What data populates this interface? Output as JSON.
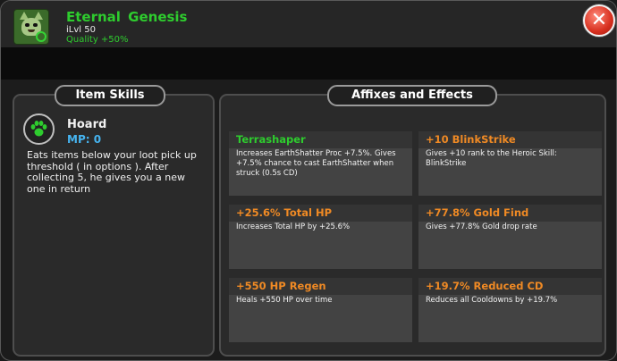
{
  "header": {
    "item_name": "Eternal Genesis",
    "ilvl": "iLvl 50",
    "quality": "Quality +50%",
    "close_icon": "close-x-icon",
    "pet_icon": "green-creature-portrait-icon"
  },
  "skills_panel": {
    "title": "Item Skills",
    "skill": {
      "icon": "paw-icon",
      "name": "Hoard",
      "mp": "MP: 0",
      "description": "Eats items below your loot pick up threshold ( in options ). After collecting 5, he gives you a new one in return"
    }
  },
  "affixes_panel": {
    "title": "Affixes and Effects",
    "cards": [
      {
        "name": "Terrashaper",
        "desc": "Increases EarthShatter Proc +7.5%. Gives +7.5% chance to cast EarthShatter when struck (0.5s CD)",
        "color": "#2ecc2e"
      },
      {
        "name": "+10 BlinkStrike",
        "desc": "Gives +10 rank to the Heroic Skill: BlinkStrike",
        "color": "#f08a24"
      },
      {
        "name": "+25.6% Total HP",
        "desc": "Increases Total HP by +25.6%",
        "color": "#f08a24"
      },
      {
        "name": "+77.8% Gold Find",
        "desc": "Gives +77.8% Gold drop rate",
        "color": "#f08a24"
      },
      {
        "name": "+550 HP Regen",
        "desc": "Heals +550 HP over time",
        "color": "#f08a24"
      },
      {
        "name": "+19.7% Reduced CD",
        "desc": "Reduces all Cooldowns by +19.7%",
        "color": "#f08a24"
      }
    ]
  },
  "colors": {
    "accent_green": "#2ecc2e",
    "accent_orange": "#f08a24",
    "mp_blue": "#46b4f0",
    "close_red": "#d8301f"
  }
}
